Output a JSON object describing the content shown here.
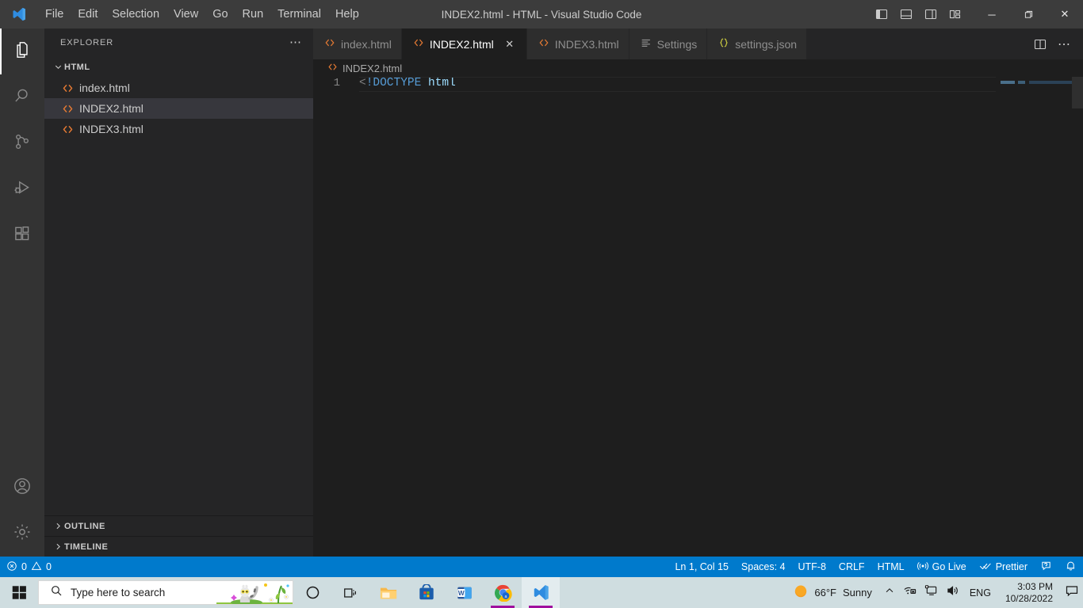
{
  "window": {
    "title": "INDEX2.html - HTML - Visual Studio Code",
    "logo_icon": "vscode-logo-icon",
    "menu": [
      "File",
      "Edit",
      "Selection",
      "View",
      "Go",
      "Run",
      "Terminal",
      "Help"
    ],
    "layout_icons": [
      {
        "name": "toggle-primary-sidebar-icon",
        "label": "Toggle Primary Side Bar"
      },
      {
        "name": "toggle-panel-icon",
        "label": "Toggle Panel"
      },
      {
        "name": "toggle-secondary-sidebar-icon",
        "label": "Toggle Secondary Side Bar"
      },
      {
        "name": "customize-layout-icon",
        "label": "Customize Layout"
      }
    ],
    "controls": {
      "minimize": "─",
      "maximize": "❐",
      "close": "✕"
    }
  },
  "activitybar": {
    "items": [
      {
        "name": "explorer",
        "icon": "files-icon",
        "active": true
      },
      {
        "name": "search",
        "icon": "search-icon",
        "active": false
      },
      {
        "name": "source-control",
        "icon": "source-control-icon",
        "active": false
      },
      {
        "name": "run-and-debug",
        "icon": "run-debug-icon",
        "active": false
      },
      {
        "name": "extensions",
        "icon": "extensions-icon",
        "active": false
      }
    ],
    "bottom": [
      {
        "name": "accounts",
        "icon": "account-icon"
      },
      {
        "name": "manage",
        "icon": "gear-icon"
      }
    ]
  },
  "sidebar": {
    "title": "EXPLORER",
    "more_icon": "ellipsis-icon",
    "folder": {
      "name": "HTML",
      "expanded": true,
      "twisty": "chevron-down-icon"
    },
    "files": [
      {
        "name": "index.html",
        "icon": "html-file-icon",
        "selected": false
      },
      {
        "name": "INDEX2.html",
        "icon": "html-file-icon",
        "selected": true
      },
      {
        "name": "INDEX3.html",
        "icon": "html-file-icon",
        "selected": false
      }
    ],
    "sections": [
      {
        "label": "OUTLINE",
        "twisty": "chevron-right-icon",
        "expanded": false
      },
      {
        "label": "TIMELINE",
        "twisty": "chevron-right-icon",
        "expanded": false
      }
    ]
  },
  "editor": {
    "tabs": [
      {
        "label": "index.html",
        "icon": "html-file-icon",
        "icon_color": "#e37933",
        "active": false,
        "dirty": false
      },
      {
        "label": "INDEX2.html",
        "icon": "html-file-icon",
        "icon_color": "#e37933",
        "active": true,
        "close": "✕"
      },
      {
        "label": "INDEX3.html",
        "icon": "html-file-icon",
        "icon_color": "#e37933",
        "active": false
      },
      {
        "label": "Settings",
        "icon": "settings-list-icon",
        "icon_color": "#8f8f8f",
        "active": false
      },
      {
        "label": "settings.json",
        "icon": "json-braces-icon",
        "icon_color": "#cbcb41",
        "active": false
      }
    ],
    "tab_actions": [
      {
        "name": "split-editor-right-icon"
      },
      {
        "name": "editor-more-actions-icon"
      }
    ],
    "breadcrumb": {
      "icon": "html-file-icon",
      "label": "INDEX2.html"
    },
    "code": {
      "lines": [
        {
          "number": "1",
          "tokens": [
            {
              "text": "<",
              "type": "punc"
            },
            {
              "text": "!DOCTYPE",
              "type": "meta"
            },
            {
              "text": " ",
              "type": "punc"
            },
            {
              "text": "html",
              "type": "name"
            }
          ]
        }
      ]
    }
  },
  "statusbar": {
    "left": [
      {
        "name": "problems",
        "icon": "error-icon",
        "errors": "0",
        "warn_icon": "warning-icon",
        "warnings": "0"
      }
    ],
    "errors_label": "0",
    "warnings_label": "0",
    "right": [
      {
        "name": "editor-position",
        "label": "Ln 1, Col 15"
      },
      {
        "name": "editor-indentation",
        "label": "Spaces: 4"
      },
      {
        "name": "editor-encoding",
        "label": "UTF-8"
      },
      {
        "name": "editor-eol",
        "label": "CRLF"
      },
      {
        "name": "editor-language",
        "label": "HTML"
      },
      {
        "name": "go-live",
        "label": "Go Live",
        "icon": "broadcast-icon"
      },
      {
        "name": "prettier",
        "label": "Prettier",
        "icon": "check-all-icon"
      }
    ],
    "feedback_icon": "feedback-icon",
    "bell_icon": "bell-icon",
    "accent": "#007acc"
  },
  "taskbar": {
    "start_icon": "windows-start-icon",
    "search_placeholder": "Type here to search",
    "search_icon": "search-icon",
    "decoration": "lemur-illustration",
    "apps": [
      {
        "name": "cortana",
        "icon": "cortana-circle-icon",
        "running": false,
        "active": false
      },
      {
        "name": "task-view",
        "icon": "task-view-icon",
        "running": false,
        "active": false
      },
      {
        "name": "file-explorer",
        "icon": "file-explorer-icon",
        "running": false,
        "active": false
      },
      {
        "name": "microsoft-store",
        "icon": "microsoft-store-icon",
        "running": false,
        "active": false
      },
      {
        "name": "word",
        "icon": "word-icon",
        "running": false,
        "active": false
      },
      {
        "name": "chrome",
        "icon": "chrome-icon",
        "running": true,
        "active": false
      },
      {
        "name": "vscode",
        "icon": "vscode-icon",
        "running": true,
        "active": true
      }
    ],
    "tray": {
      "weather_temp": "66°F",
      "weather_desc": "Sunny",
      "weather_icon": "sun-icon",
      "chevron_icon": "chevron-up-icon",
      "network_icon": "network-icon",
      "display_icon": "display-icon",
      "volume_icon": "volume-icon",
      "language": "ENG",
      "time": "3:03 PM",
      "date": "10/28/2022",
      "action_center_icon": "action-center-icon"
    }
  }
}
